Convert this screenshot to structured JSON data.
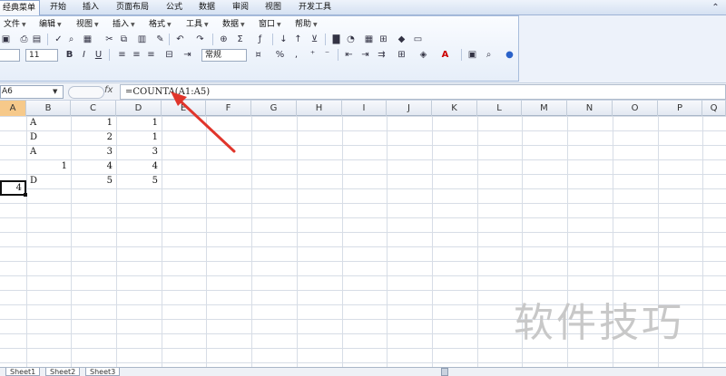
{
  "ribbon_tabs": [
    "经典菜单",
    "开始",
    "插入",
    "页面布局",
    "公式",
    "数据",
    "审阅",
    "视图",
    "开发工具"
  ],
  "menus": [
    "文件",
    "编辑",
    "视图",
    "插入",
    "格式",
    "工具",
    "数据",
    "窗口",
    "帮助"
  ],
  "toolbar": {
    "font_size": "11",
    "bold": "B",
    "italic": "I",
    "underline": "U",
    "number_format": "常规",
    "percent": "%",
    "comma": ","
  },
  "formula_bar": {
    "name_box": "A6",
    "fx_label": "fx",
    "formula": "=COUNTA(A1:A5)"
  },
  "columns": [
    "A",
    "B",
    "C",
    "D",
    "E",
    "F",
    "G",
    "H",
    "I",
    "J",
    "K",
    "L",
    "M",
    "N",
    "O",
    "P",
    "Q"
  ],
  "cells": {
    "b1": "A",
    "c1": "1",
    "d1": "1",
    "b2": "D",
    "c2": "2",
    "d2": "1",
    "b3": "A",
    "c3": "3",
    "d3": "3",
    "a4": "1",
    "c4": "4",
    "d4": "4",
    "b5": "D",
    "c5": "5",
    "d5": "5",
    "a6": "4"
  },
  "sheets": [
    "Sheet1",
    "Sheet2",
    "Sheet3"
  ],
  "watermark": "软件技巧",
  "colors": {
    "selected_header": "#f6c98a",
    "arrow": "#e0352b"
  }
}
